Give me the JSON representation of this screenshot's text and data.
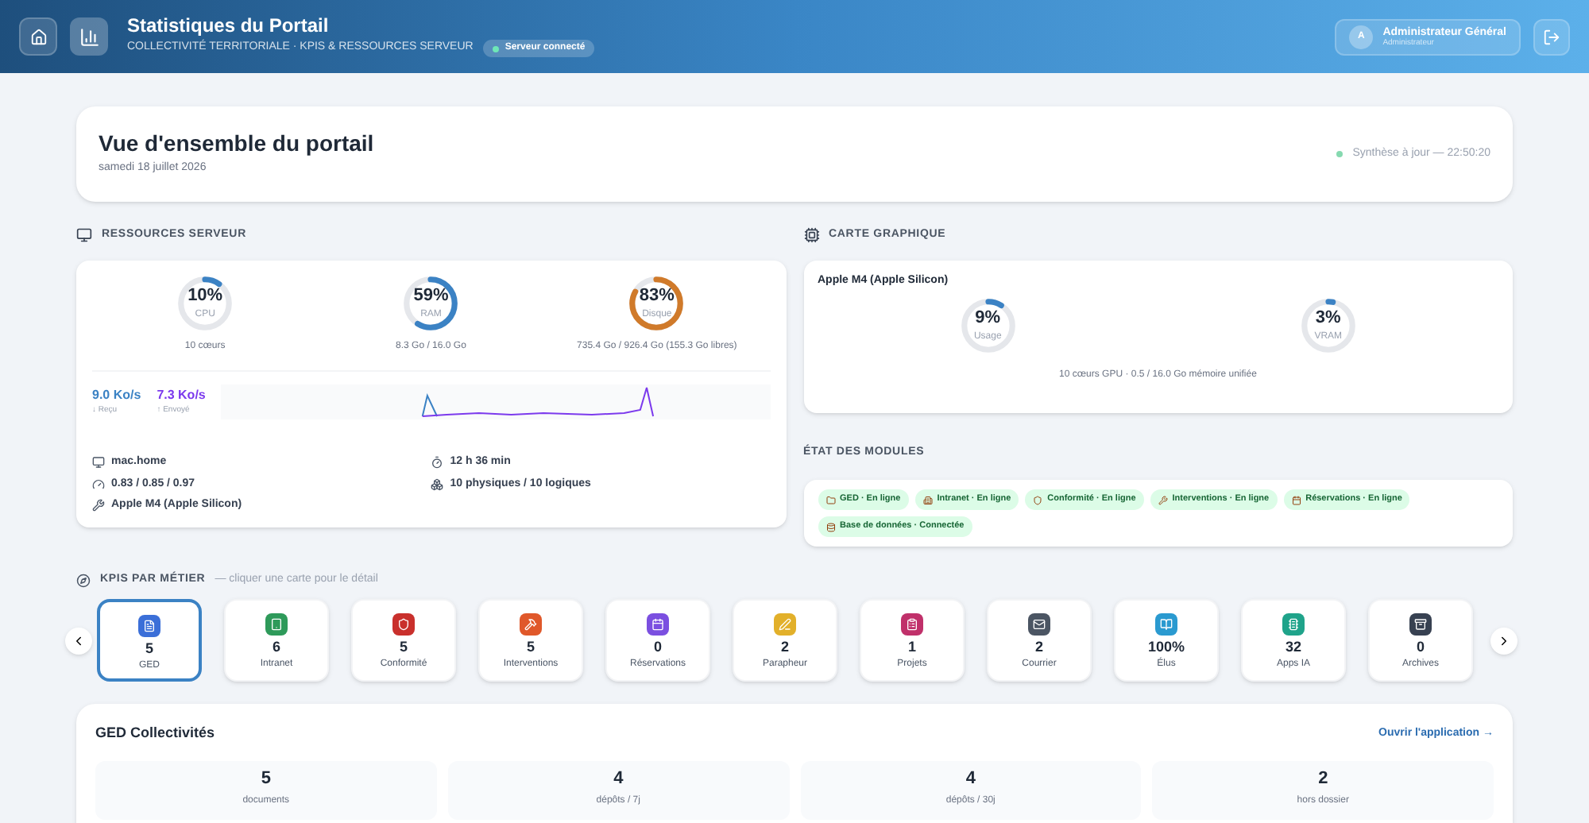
{
  "header": {
    "title": "Statistiques du Portail",
    "subtitle": "COLLECTIVITÉ TERRITORIALE · KPIS & RESSOURCES SERVEUR",
    "status": "Serveur connecté",
    "user": {
      "initial": "A",
      "name": "Administrateur Général",
      "role": "Administrateur"
    }
  },
  "overview": {
    "title": "Vue d'ensemble du portail",
    "date": "samedi 18 juillet 2026",
    "sync": "Synthèse à jour — 22:50:20"
  },
  "server": {
    "label": "RESSOURCES SERVEUR",
    "gauges": [
      {
        "value": "10%",
        "name": "CPU",
        "level": 0.1,
        "color": "#3b82c4",
        "detail": "10 cœurs"
      },
      {
        "value": "59%",
        "name": "RAM",
        "level": 0.59,
        "color": "#3b82c4",
        "detail": "8.3 Go / 16.0 Go"
      },
      {
        "value": "83%",
        "name": "Disque",
        "level": 0.83,
        "color": "#d07a2a",
        "detail": "735.4 Go / 926.4 Go (155.3 Go libres)"
      }
    ],
    "received": {
      "value": "9.0 Ko/s",
      "label": "↓ Reçu"
    },
    "sent": {
      "value": "7.3 Ko/s",
      "label": "↑ Envoyé"
    },
    "info": [
      {
        "kind": "host",
        "text": "mac.home"
      },
      {
        "kind": "uptime",
        "text": "12 h 36 min"
      },
      {
        "kind": "load",
        "text": "0.83 / 0.85 / 0.97"
      },
      {
        "kind": "cores",
        "text": "10 physiques / 10 logiques"
      },
      {
        "kind": "chip",
        "text": "Apple M4 (Apple Silicon)"
      }
    ]
  },
  "gpu": {
    "label": "CARTE GRAPHIQUE",
    "name": "Apple M4 (Apple Silicon)",
    "gauges": [
      {
        "value": "9%",
        "name": "Usage",
        "level": 0.09,
        "color": "#3b82c4"
      },
      {
        "value": "3%",
        "name": "VRAM",
        "level": 0.03,
        "color": "#3b82c4"
      }
    ],
    "detail": "10 cœurs GPU · 0.5 / 16.0 Go mémoire unifiée"
  },
  "modules": {
    "label": "ÉTAT DES MODULES",
    "items": [
      {
        "kind": "folder",
        "text": "GED · En ligne"
      },
      {
        "kind": "building",
        "text": "Intranet · En ligne"
      },
      {
        "kind": "shield",
        "text": "Conformité · En ligne"
      },
      {
        "kind": "wrench",
        "text": "Interventions · En ligne"
      },
      {
        "kind": "calendar",
        "text": "Réservations · En ligne"
      },
      {
        "kind": "database",
        "text": "Base de données · Connectée"
      }
    ]
  },
  "kpis": {
    "label": "KPIS PAR MÉTIER",
    "hint": "— cliquer une carte pour le détail",
    "cards": [
      {
        "kind": "file",
        "value": "5",
        "name": "GED",
        "color": "#3b6fd8",
        "selected": true
      },
      {
        "kind": "tablet",
        "value": "6",
        "name": "Intranet",
        "color": "#2e9a5a",
        "selected": false
      },
      {
        "kind": "shield",
        "value": "5",
        "name": "Conformité",
        "color": "#c9302c",
        "selected": false
      },
      {
        "kind": "tools",
        "value": "5",
        "name": "Interventions",
        "color": "#e0582a",
        "selected": false
      },
      {
        "kind": "calendar",
        "value": "0",
        "name": "Réservations",
        "color": "#7b4fe0",
        "selected": false
      },
      {
        "kind": "pen",
        "value": "2",
        "name": "Parapheur",
        "color": "#e2b02a",
        "selected": false
      },
      {
        "kind": "clipboard",
        "value": "1",
        "name": "Projets",
        "color": "#c0306a",
        "selected": false
      },
      {
        "kind": "mail",
        "value": "2",
        "name": "Courrier",
        "color": "#4b5563",
        "selected": false
      },
      {
        "kind": "book",
        "value": "100%",
        "name": "Élus",
        "color": "#2a9ad0",
        "selected": false
      },
      {
        "kind": "chip",
        "value": "32",
        "name": "Apps IA",
        "color": "#1fa38a",
        "selected": false
      },
      {
        "kind": "box",
        "value": "0",
        "name": "Archives",
        "color": "#374151",
        "selected": false
      }
    ]
  },
  "detail": {
    "title": "GED Collectivités",
    "link": "Ouvrir l'application →",
    "stats": [
      {
        "value": "5",
        "label": "documents"
      },
      {
        "value": "4",
        "label": "dépôts / 7j"
      },
      {
        "value": "4",
        "label": "dépôts / 30j"
      },
      {
        "value": "2",
        "label": "hors dossier"
      }
    ]
  }
}
